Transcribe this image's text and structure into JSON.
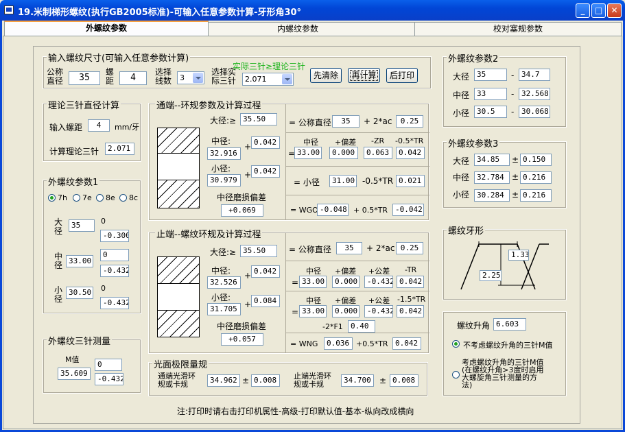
{
  "window": {
    "title": "19.米制梯形螺纹(执行GB2005标准)-可输入任意参数计算-牙形角30°"
  },
  "tabs": [
    "外螺纹参数",
    "内螺纹参数",
    "校对塞规参数"
  ],
  "input_group": {
    "title": "输入螺纹尺寸(可输入任意参数计算)",
    "nominal_label": "公称\n直径",
    "nominal": "35",
    "pitch_label": "螺\n距",
    "pitch": "4",
    "starts_label": "选择\n线数",
    "starts": "3",
    "wire_label": "选择实\n际三针",
    "wire": "2.071",
    "hint": "实际三针≥理论三针",
    "btn_clear": "先清除",
    "btn_calc": "再计算",
    "btn_print": "后打印"
  },
  "theory": {
    "title": "理论三针直径计算",
    "pitch_label": "输入螺距",
    "pitch": "4",
    "unit": "mm/牙",
    "calc_label": "计算理论三针",
    "result": "2.071"
  },
  "ext1": {
    "title": "外螺纹参数1",
    "radios": [
      "7h",
      "7e",
      "8e",
      "8c"
    ],
    "major_label": "大\n径",
    "major": "35",
    "major_up": "0",
    "major_low": "-0.300",
    "pitch_label": "中\n径",
    "pitch": "33.00",
    "pitch_up": "0",
    "pitch_low": "-0.432",
    "minor_label": "小\n径",
    "minor": "30.50",
    "minor_up": "0",
    "minor_low": "-0.432"
  },
  "wire_meas": {
    "title": "外螺纹三针测量",
    "m_label": "M值",
    "m": "35.609",
    "up": "0",
    "low": "-0.432"
  },
  "go": {
    "title": "通端--环规参数及计算过程",
    "major_label": "大径:≥",
    "major": "35.50",
    "pitch_label": "中径:",
    "pitch": "32.916",
    "pitch_plus": "0.042",
    "minor_label": "小径:",
    "minor": "30.979",
    "minor_plus": "0.042",
    "wear_label": "中径磨损偏差",
    "wear": "+0.069",
    "r1_eq": "= 公称直径",
    "r1_v1": "35",
    "r1_op": "+ 2*ac",
    "r1_v2": "0.25",
    "r2_h": [
      "中径",
      "+偏差",
      "-ZR",
      "-0.5*TR"
    ],
    "r2_v": [
      "33.00",
      "0.000",
      "0.063",
      "0.042"
    ],
    "r3_eq": "=  小径",
    "r3_v1": "31.00",
    "r3_op": "-0.5*TR",
    "r3_v2": "0.021",
    "r4_eq": "= WGO",
    "r4_v1": "-0.048",
    "r4_op": "+ 0.5*TR",
    "r4_v2": "-0.042"
  },
  "nogo": {
    "title": "止端--螺纹环规及计算过程",
    "major_label": "大径:≥",
    "major": "35.50",
    "pitch_label": "中径:",
    "pitch": "32.526",
    "pitch_plus": "0.042",
    "minor_label": "小径:",
    "minor": "31.705",
    "minor_plus": "0.084",
    "wear_label": "中径磨损偏差",
    "wear": "+0.057",
    "r1_eq": "= 公称直径",
    "r1_v1": "35",
    "r1_op": "+ 2*ac",
    "r1_v2": "0.25",
    "r2_h": [
      "中径",
      "+偏差",
      "+公差",
      "-TR"
    ],
    "r2_v": [
      "33.00",
      "0.000",
      "-0.432",
      "0.042"
    ],
    "r3_h": [
      "中径",
      "+偏差",
      "+公差",
      "-1.5*TR"
    ],
    "r3_v": [
      "33.00",
      "0.000",
      "-0.432",
      "0.042"
    ],
    "r3_f1_label": "-2*F1",
    "r3_f1": "0.40",
    "r4_eq": "= WNG",
    "r4_v1": "0.036",
    "r4_op": "+0.5*TR",
    "r4_v2": "0.042"
  },
  "smooth": {
    "title": "光面极限量规",
    "go_label": "通端光滑环\n规或卡规",
    "go_v": "34.962",
    "go_tol": "0.008",
    "nogo_label": "止端光滑环\n规或卡规",
    "nogo_v": "34.700",
    "nogo_tol": "0.008"
  },
  "ext2": {
    "title": "外螺纹参数2",
    "rows": [
      {
        "label": "大径",
        "a": "35",
        "b": "34.7"
      },
      {
        "label": "中径",
        "a": "33",
        "b": "32.568"
      },
      {
        "label": "小径",
        "a": "30.5",
        "b": "30.068"
      }
    ],
    "sep": "-"
  },
  "ext3": {
    "title": "外螺纹参数3",
    "rows": [
      {
        "label": "大径",
        "a": "34.85",
        "b": "0.150"
      },
      {
        "label": "中径",
        "a": "32.784",
        "b": "0.216"
      },
      {
        "label": "小径",
        "a": "30.284",
        "b": "0.216"
      }
    ],
    "sep": "±"
  },
  "profile": {
    "title": "螺纹牙形",
    "top": "1.33",
    "side": "2.25"
  },
  "lead": {
    "label": "螺纹升角",
    "value": "6.603",
    "opt1": "不考虑螺纹升角的三针M值",
    "opt2": "考虑螺纹升角的三针M值\n(在螺纹升角>3度时启用\n大螺旋角三针测量的方\n法)"
  },
  "note": "注:打印时请右击打印机属性-高级-打印默认值-基本-纵向改成横向"
}
